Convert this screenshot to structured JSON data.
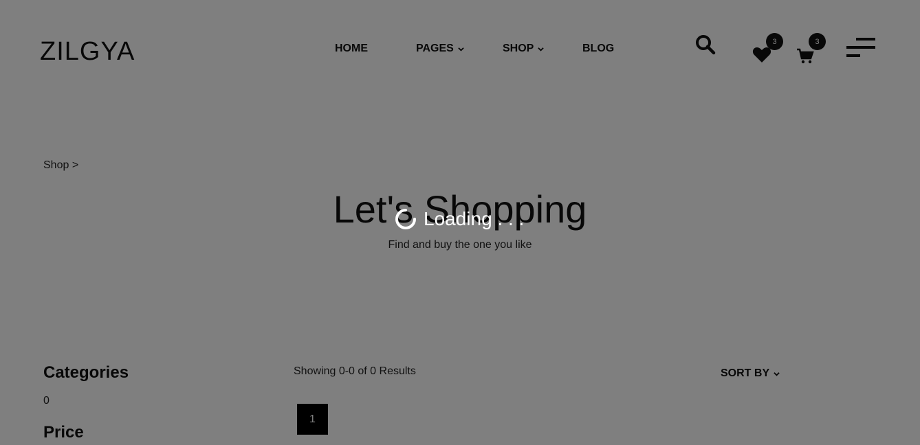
{
  "header": {
    "logo": "ZILGYA",
    "nav": [
      {
        "label": "HOME"
      },
      {
        "label": "PAGES"
      },
      {
        "label": "SHOP"
      },
      {
        "label": "BLOG"
      }
    ],
    "wishlist_count": "3",
    "cart_count": "3"
  },
  "breadcrumb": "Shop >",
  "hero": {
    "title": "Let's Shopping",
    "subtitle": "Find and buy the one you like"
  },
  "sidebar": {
    "categories_title": "Categories",
    "categories_count": "0",
    "price_title": "Price"
  },
  "toolbar": {
    "results": "Showing 0-0 of 0 Results",
    "sort_label": "SORT BY"
  },
  "pagination": {
    "current_page": "1"
  },
  "loading": {
    "text": "Loading . . ."
  },
  "colors": {
    "overlay": "#808080",
    "accent": "#000000"
  }
}
